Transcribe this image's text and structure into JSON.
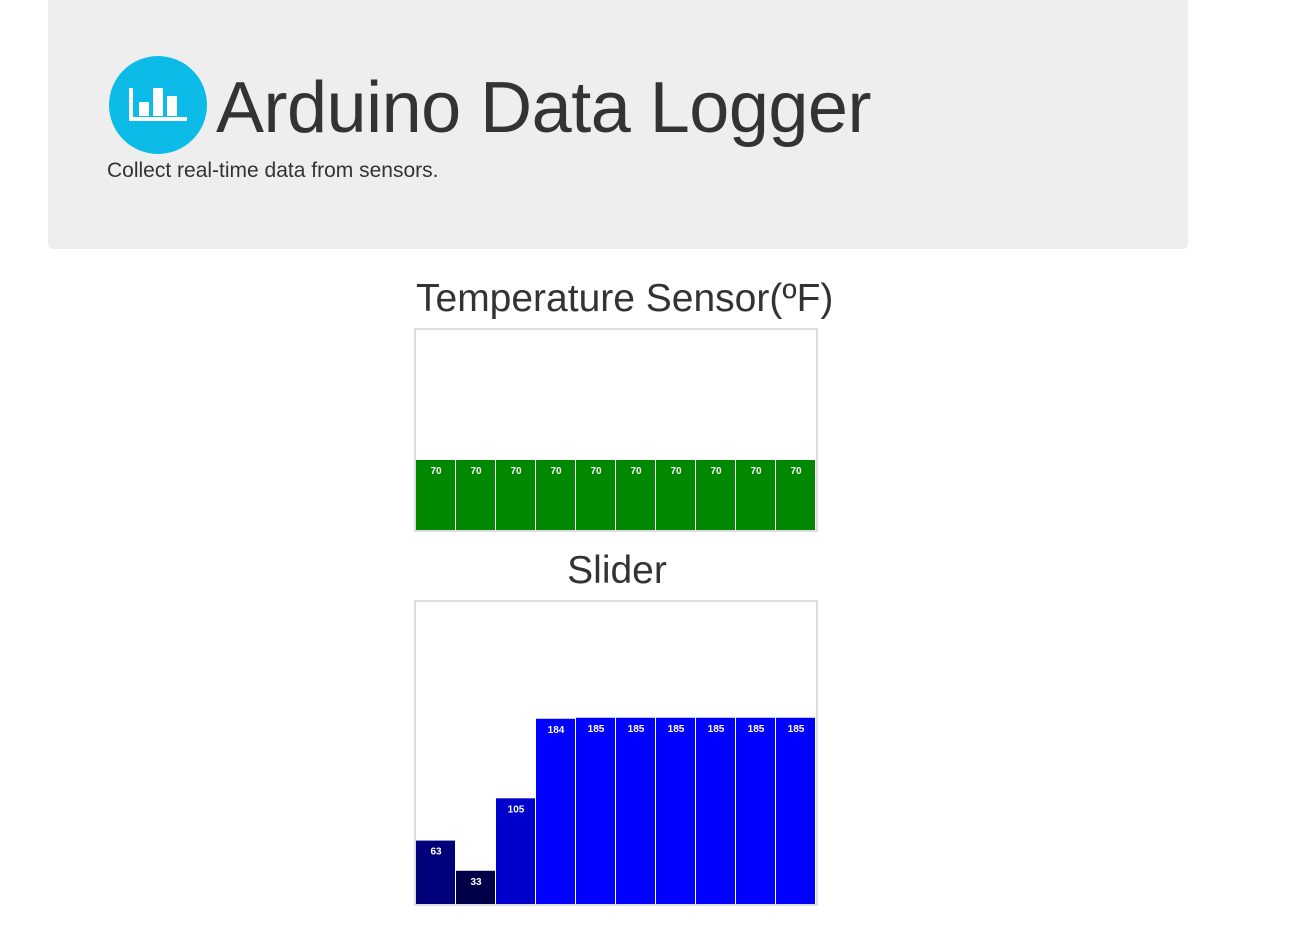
{
  "header": {
    "title": "Arduino Data Logger",
    "subtitle": "Collect real-time data from sensors.",
    "logo_icon": "bar-chart-icon",
    "logo_color": "#0dbbe8"
  },
  "chart_data": [
    {
      "type": "bar",
      "title": "Temperature Sensor(ºF)",
      "categories": [],
      "values": [
        70,
        70,
        70,
        70,
        70,
        70,
        70,
        70,
        70,
        70
      ],
      "ylim": [
        0,
        200
      ],
      "grid": false,
      "bar_color": "#008800",
      "label_color": "#ffffff"
    },
    {
      "type": "bar",
      "title": "Slider",
      "categories": [],
      "values": [
        63,
        33,
        105,
        184,
        185,
        185,
        185,
        185,
        185,
        185
      ],
      "ylim": [
        0,
        300
      ],
      "grid": false,
      "bar_colors": [
        "#00007b",
        "#00004a",
        "#0000cc",
        "#0000ff",
        "#0000ff",
        "#0000ff",
        "#0000ff",
        "#0000ff",
        "#0000ff",
        "#0000ff"
      ],
      "label_color": "#ffffff"
    }
  ]
}
